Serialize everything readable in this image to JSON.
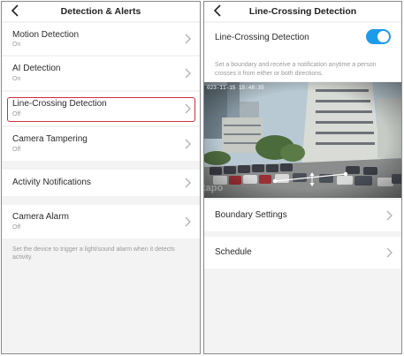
{
  "left_screen": {
    "title": "Detection & Alerts",
    "items": [
      {
        "label": "Motion Detection",
        "status": "On"
      },
      {
        "label": "AI Detection",
        "status": "On"
      },
      {
        "label": "Line-Crossing Detection",
        "status": "Off"
      },
      {
        "label": "Camera Tampering",
        "status": "Off"
      },
      {
        "label": "Activity Notifications",
        "status": ""
      },
      {
        "label": "Camera Alarm",
        "status": "Off"
      }
    ],
    "footnote": "Set the device to trigger a light/sound alarm when it detects activity."
  },
  "right_screen": {
    "title": "Line-Crossing Detection",
    "toggle_label": "Line-Crossing Detection",
    "toggle_state": "on",
    "description": "Set a boundary and receive a notification anytime a person crosses it from either or both directions.",
    "camera_timestamp": "023-11-15 15:48:35",
    "camera_watermark": "tapo",
    "items": [
      {
        "label": "Boundary Settings"
      },
      {
        "label": "Schedule"
      }
    ]
  },
  "colors": {
    "accent": "#1e9be8",
    "highlight": "#c8323c",
    "background": "#f3f3f3"
  },
  "icons": {
    "back": "chevron-left-icon",
    "row": "chevron-right-icon"
  }
}
